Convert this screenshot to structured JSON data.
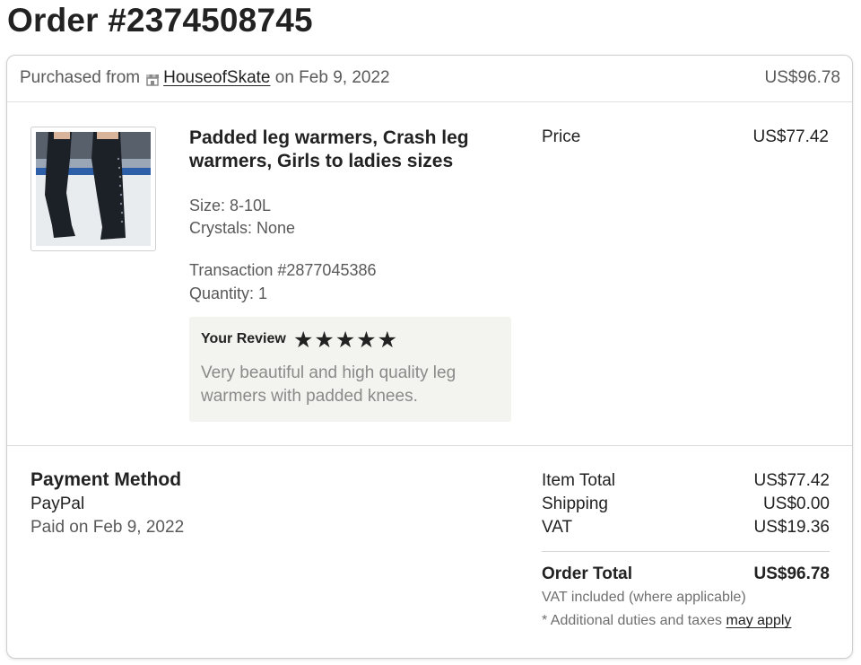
{
  "order": {
    "title": "Order #2374508745"
  },
  "header": {
    "purchased_from": "Purchased from",
    "shop_name": "HouseofSkate",
    "date_text": "on Feb 9, 2022",
    "total": "US$96.78"
  },
  "item": {
    "title": "Padded leg warmers, Crash leg warmers, Girls to ladies sizes",
    "variations": [
      "Size: 8-10L",
      "Crystals: None"
    ],
    "transaction": "Transaction #2877045386",
    "quantity": "Quantity: 1",
    "price_label": "Price",
    "price_value": "US$77.42",
    "image_icon": "leg-warmers-product-photo"
  },
  "review": {
    "label": "Your Review",
    "rating": 5,
    "stars": "★★★★★",
    "text": "Very beautiful and high quality leg warmers with padded knees."
  },
  "payment": {
    "title": "Payment Method",
    "method": "PayPal",
    "paid_on": "Paid on Feb 9, 2022"
  },
  "summary": {
    "item_total_label": "Item Total",
    "item_total_value": "US$77.42",
    "shipping_label": "Shipping",
    "shipping_value": "US$0.00",
    "vat_label": "VAT",
    "vat_value": "US$19.36",
    "order_total_label": "Order Total",
    "order_total_value": "US$96.78",
    "vat_note": "VAT included (where applicable)",
    "duty_note_prefix": "* Additional duties and taxes",
    "duty_note_link": "may apply"
  },
  "colors": {
    "text_primary": "#222222",
    "text_secondary": "#595959",
    "review_bg": "#f3f3ef",
    "border": "#cfcfcf"
  }
}
